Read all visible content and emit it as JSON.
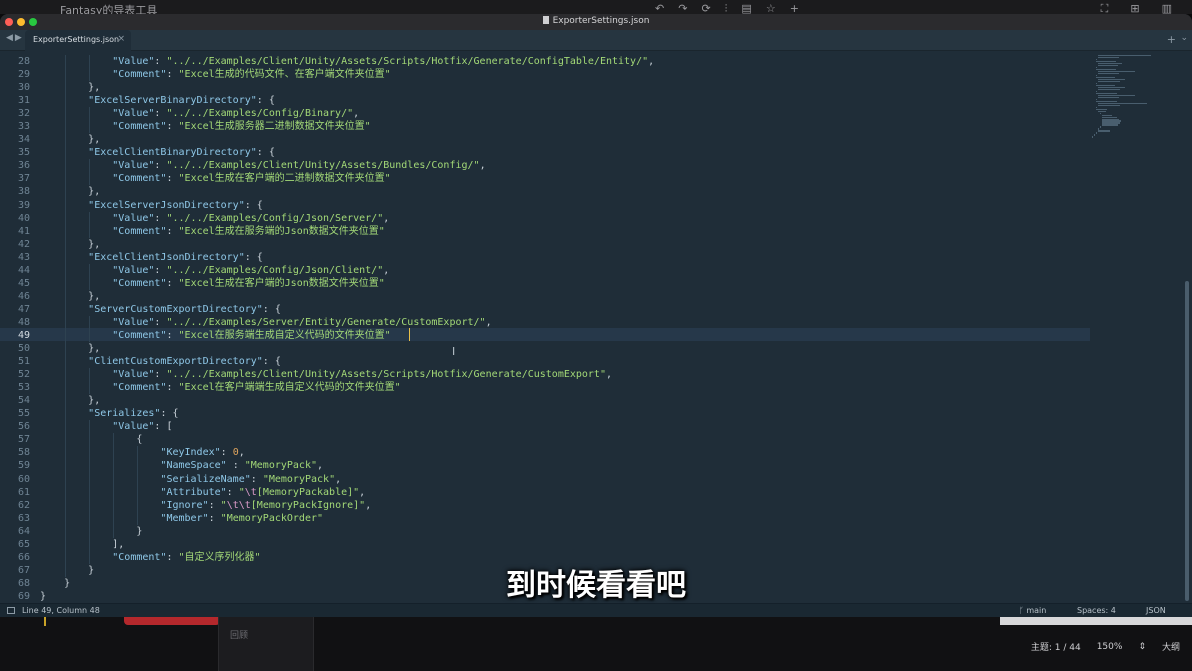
{
  "background_app": {
    "title": "Fantasy的导表工具",
    "toolbar_icons": [
      "undo-icon",
      "redo-icon",
      "refresh-icon",
      "split-icon",
      "note-icon",
      "star-icon",
      "plus-icon"
    ],
    "panel_item": "回顾",
    "status": {
      "theme": "主题: 1 / 44",
      "zoom": "150%",
      "outline": "大纲"
    }
  },
  "window": {
    "title": "ExporterSettings.json"
  },
  "tab": {
    "label": "ExporterSettings.json",
    "close": "×",
    "add": "+",
    "menu": "⌄"
  },
  "editor": {
    "line_numbers": [
      "28",
      "29",
      "30",
      "31",
      "32",
      "33",
      "34",
      "35",
      "36",
      "37",
      "38",
      "39",
      "40",
      "41",
      "42",
      "43",
      "44",
      "45",
      "46",
      "47",
      "48",
      "49",
      "50",
      "51",
      "52",
      "53",
      "54",
      "55",
      "56",
      "57",
      "58",
      "59",
      "60",
      "61",
      "62",
      "63",
      "64",
      "65",
      "66",
      "67",
      "68",
      "69"
    ],
    "active_line": "49",
    "code": [
      {
        "i": 3,
        "k": "Value",
        "v": "../../Examples/Client/Unity/Assets/Scripts/Hotfix/Generate/ConfigTable/Entity/",
        "t": ","
      },
      {
        "i": 3,
        "k": "Comment",
        "v": "Excel生成的代码文件、在客户端文件夹位置",
        "t": ""
      },
      {
        "i": 2,
        "raw": "},"
      },
      {
        "i": 2,
        "k": "ExcelServerBinaryDirectory",
        "t": ": {"
      },
      {
        "i": 3,
        "k": "Value",
        "v": "../../Examples/Config/Binary/",
        "t": ","
      },
      {
        "i": 3,
        "k": "Comment",
        "v": "Excel生成服务器二进制数据文件夹位置",
        "t": ""
      },
      {
        "i": 2,
        "raw": "},"
      },
      {
        "i": 2,
        "k": "ExcelClientBinaryDirectory",
        "t": ": {"
      },
      {
        "i": 3,
        "k": "Value",
        "v": "../../Examples/Client/Unity/Assets/Bundles/Config/",
        "t": ","
      },
      {
        "i": 3,
        "k": "Comment",
        "v": "Excel生成在客户端的二进制数据文件夹位置",
        "t": ""
      },
      {
        "i": 2,
        "raw": "},"
      },
      {
        "i": 2,
        "k": "ExcelServerJsonDirectory",
        "t": ": {"
      },
      {
        "i": 3,
        "k": "Value",
        "v": "../../Examples/Config/Json/Server/",
        "t": ","
      },
      {
        "i": 3,
        "k": "Comment",
        "v": "Excel生成在服务端的Json数据文件夹位置",
        "t": ""
      },
      {
        "i": 2,
        "raw": "},"
      },
      {
        "i": 2,
        "k": "ExcelClientJsonDirectory",
        "t": ": {"
      },
      {
        "i": 3,
        "k": "Value",
        "v": "../../Examples/Config/Json/Client/",
        "t": ","
      },
      {
        "i": 3,
        "k": "Comment",
        "v": "Excel生成在客户端的Json数据文件夹位置",
        "t": ""
      },
      {
        "i": 2,
        "raw": "},"
      },
      {
        "i": 2,
        "k": "ServerCustomExportDirectory",
        "t": ": {"
      },
      {
        "i": 3,
        "k": "Value",
        "v": "../../Examples/Server/Entity/Generate/CustomExport/",
        "t": ","
      },
      {
        "i": 3,
        "k": "Comment",
        "v": "Excel在服务端生成自定义代码的文件夹位置",
        "t": ""
      },
      {
        "i": 2,
        "raw": "},"
      },
      {
        "i": 2,
        "k": "ClientCustomExportDirectory",
        "t": ": {"
      },
      {
        "i": 3,
        "k": "Value",
        "v": "../../Examples/Client/Unity/Assets/Scripts/Hotfix/Generate/CustomExport",
        "t": ","
      },
      {
        "i": 3,
        "k": "Comment",
        "v": "Excel在客户端端生成自定义代码的文件夹位置",
        "t": ""
      },
      {
        "i": 2,
        "raw": "},"
      },
      {
        "i": 2,
        "k": "Serializes",
        "t": ": {"
      },
      {
        "i": 3,
        "k": "Value",
        "t": ": ["
      },
      {
        "i": 4,
        "raw": "{"
      },
      {
        "i": 5,
        "k": "KeyIndex",
        "n": "0",
        "t": ","
      },
      {
        "i": 5,
        "k": "NameSpace",
        "sep": " : ",
        "v": "MemoryPack",
        "t": ","
      },
      {
        "i": 5,
        "k": "SerializeName",
        "v": "MemoryPack",
        "t": ","
      },
      {
        "i": 5,
        "k": "Attribute",
        "e": "\\t",
        "v": "[MemoryPackable]",
        "t": ","
      },
      {
        "i": 5,
        "k": "Ignore",
        "e": "\\t\\t",
        "v": "[MemoryPackIgnore]",
        "t": ","
      },
      {
        "i": 5,
        "k": "Member",
        "v": "MemoryPackOrder",
        "t": ""
      },
      {
        "i": 4,
        "raw": "}"
      },
      {
        "i": 3,
        "raw": "],"
      },
      {
        "i": 3,
        "k": "Comment",
        "v": "自定义序列化器",
        "t": ""
      },
      {
        "i": 2,
        "raw": "}"
      },
      {
        "i": 1,
        "raw": "}"
      },
      {
        "i": 0,
        "raw": "}"
      }
    ]
  },
  "statusbar": {
    "position": "Line 49, Column 48",
    "branch": "main",
    "spaces": "Spaces: 4",
    "syntax": "JSON"
  },
  "subtitle": "到时候看看吧"
}
